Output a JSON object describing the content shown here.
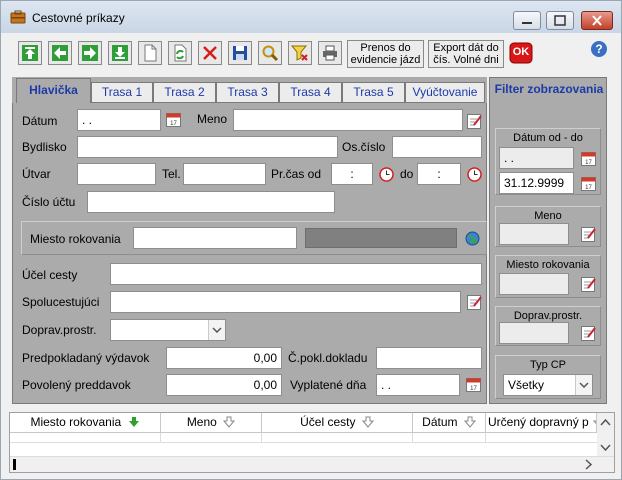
{
  "window": {
    "title": "Cestovné príkazy"
  },
  "toolbar": {
    "transfer_label_1": "Prenos do",
    "transfer_label_2": "evidencie jázd",
    "export_label_1": "Export dát do",
    "export_label_2": "čís. Volné dni",
    "ok_label": "OK",
    "help_label": "?"
  },
  "tabs": [
    "Hlavička",
    "Trasa 1",
    "Trasa 2",
    "Trasa 3",
    "Trasa 4",
    "Trasa 5",
    "Vyúčtovanie"
  ],
  "form": {
    "datum_label": "Dátum",
    "datum_value": " .   .",
    "meno_label": "Meno",
    "bydlisko_label": "Bydlisko",
    "oscislo_label": "Os.číslo",
    "utvar_label": "Útvar",
    "tel_label": "Tel.",
    "prcas_label": "Pr.čas od",
    "prcas_from": ":",
    "do_label": "do",
    "prcas_to": ":",
    "cisloUctu_label": "Číslo účtu",
    "miesto_label": "Miesto rokovania",
    "ucel_label": "Účel cesty",
    "spolucestujuci_label": "Spolucestujúci",
    "doprav_label": "Doprav.prostr.",
    "predpokladany_label": "Predpokladaný výdavok",
    "predpokladany_value": "0,00",
    "cpokl_label": "Č.pokl.dokladu",
    "povoleny_label": "Povolený preddavok",
    "povoleny_value": "0,00",
    "vyplatene_label": "Vyplatené dňa",
    "vyplatene_value": " .   ."
  },
  "filter": {
    "title": "Filter zobrazovania",
    "datum_label": "Dátum od - do",
    "datum_from": " .   .",
    "datum_to": "31.12.9999",
    "meno_label": "Meno",
    "miesto_label": "Miesto rokovania",
    "doprav_label": "Doprav.prostr.",
    "typ_label": "Typ CP",
    "typ_value": "Všetky"
  },
  "grid": {
    "columns": [
      "Miesto rokovania",
      "Meno",
      "Účel cesty",
      "Dátum",
      "Určený dopravný p"
    ]
  },
  "colors": {
    "accent": "#1d3aa8",
    "panel": "#ababab",
    "ok_red": "#d81818",
    "sort_green": "#2ea02e"
  }
}
